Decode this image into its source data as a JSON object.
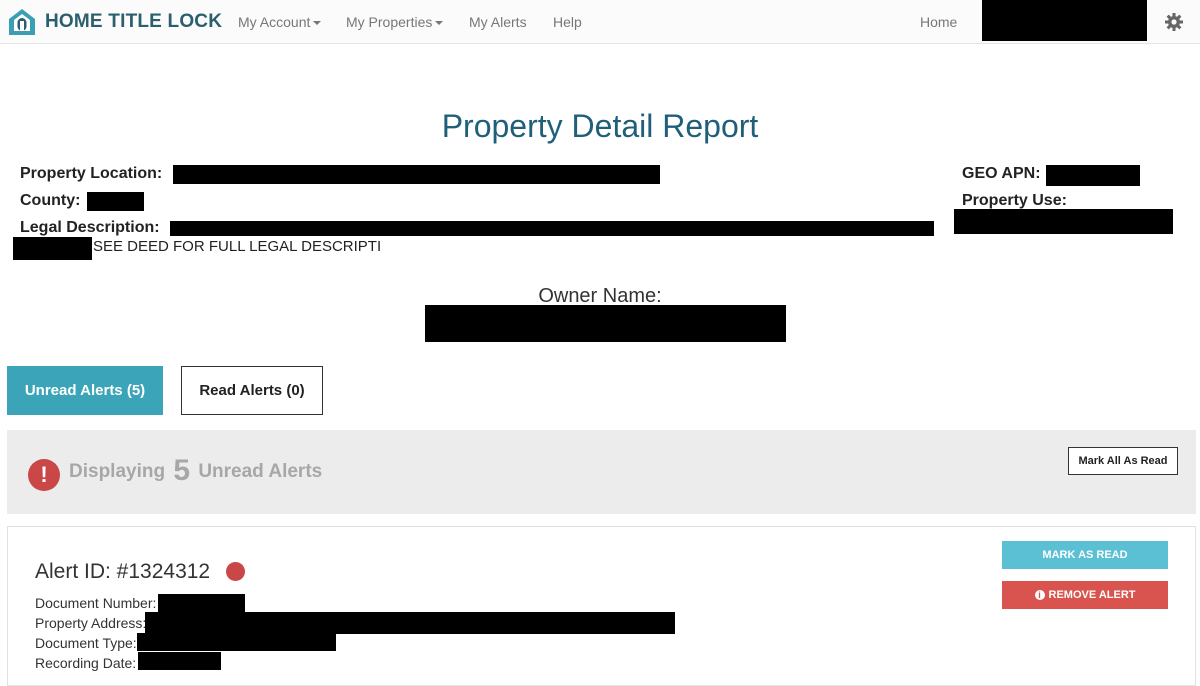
{
  "navbar": {
    "brand": "HOME TITLE LOCK",
    "menu": [
      {
        "label": "My Account",
        "dropdown": true
      },
      {
        "label": "My Properties",
        "dropdown": true
      },
      {
        "label": "My Alerts",
        "dropdown": false
      },
      {
        "label": "Help",
        "dropdown": false
      }
    ],
    "home_label": "Home",
    "user_menu_redacted": true,
    "settings_icon": "gear-icon"
  },
  "report": {
    "title": "Property Detail Report",
    "property_location_label": "Property Location:",
    "county_label": "County:",
    "legal_description_label": "Legal Description:",
    "legal_description_tail": "SEE DEED FOR FULL LEGAL DESCRIPTI",
    "geo_apn_label": "GEO APN:",
    "property_use_label": "Property Use:",
    "owner_name_label": "Owner Name:"
  },
  "tabs": [
    {
      "label": "Unread Alerts (5)",
      "active": true
    },
    {
      "label": "Read Alerts (0)",
      "active": false
    }
  ],
  "banner": {
    "prefix": "Displaying",
    "count": "5",
    "suffix": "Unread Alerts",
    "icon": "exclamation-icon",
    "mark_all_label": "Mark All As Read"
  },
  "alert": {
    "id_label": "Alert ID: #1324312",
    "status": "unread",
    "document_number_label": "Document Number:",
    "property_address_label": "Property Address:",
    "document_type_label": "Document Type:",
    "recording_date_label": "Recording Date:",
    "mark_read_label": "MARK AS READ",
    "remove_label": "REMOVE ALERT"
  },
  "colors": {
    "brand": "#2b5f6f",
    "title": "#1f5f7a",
    "active_tab": "#3ba4b8",
    "mark_read": "#5bc0d3",
    "danger": "#d9534f",
    "banner_bg": "#ececec"
  }
}
